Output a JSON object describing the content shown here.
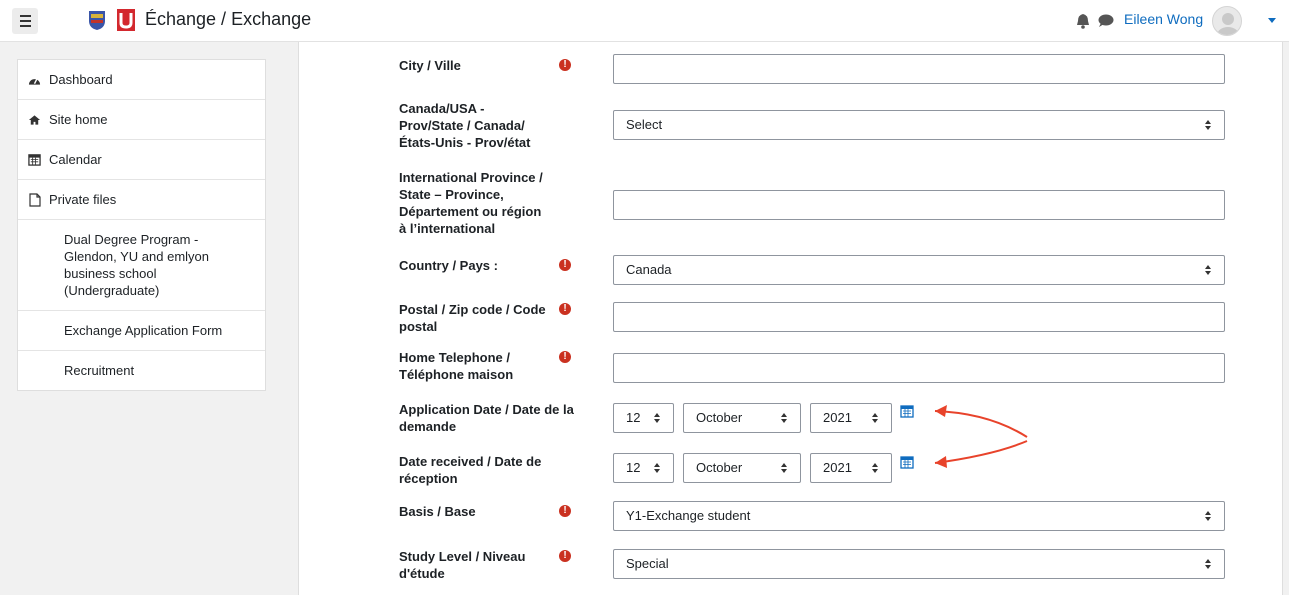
{
  "header": {
    "site_title": "Échange / Exchange",
    "user_name": "Eileen Wong",
    "icons": [
      "menu-icon",
      "bell-icon",
      "chat-icon",
      "user-avatar"
    ]
  },
  "nav": {
    "dashboard": "Dashboard",
    "site_home": "Site home",
    "calendar": "Calendar",
    "private_files": "Private files",
    "dual_degree": "Dual Degree Program - Glendon, YU and emlyon business school (Undergraduate)",
    "exchange_form": "Exchange Application Form",
    "recruitment": "Recruitment"
  },
  "form": {
    "required_mark": "!",
    "city": {
      "label": "City / Ville",
      "value": ""
    },
    "prov_state": {
      "label": "Canada/USA - Prov/State / Canada/ États-Unis - Prov/état",
      "value": "Select"
    },
    "intl_province": {
      "label": "International Province / State – Province, Département ou région à l’international",
      "value": ""
    },
    "country": {
      "label": "Country / Pays :",
      "value": "Canada"
    },
    "postal": {
      "label": "Postal / Zip code / Code postal",
      "value": ""
    },
    "home_phone": {
      "label": "Home Telephone / Téléphone maison",
      "value": ""
    },
    "application_date": {
      "label": "Application Date / Date de la demande",
      "day": "12",
      "month": "October",
      "year": "2021"
    },
    "date_received": {
      "label": "Date received / Date de réception",
      "day": "12",
      "month": "October",
      "year": "2021"
    },
    "basis": {
      "label": "Basis / Base",
      "value": "Y1-Exchange student"
    },
    "study_level": {
      "label": "Study Level / Niveau d'étude",
      "value": "Special"
    }
  },
  "colors": {
    "accent": "#0f6cbf",
    "required": "#ca3120",
    "annotation_arrow": "#e8432b"
  }
}
